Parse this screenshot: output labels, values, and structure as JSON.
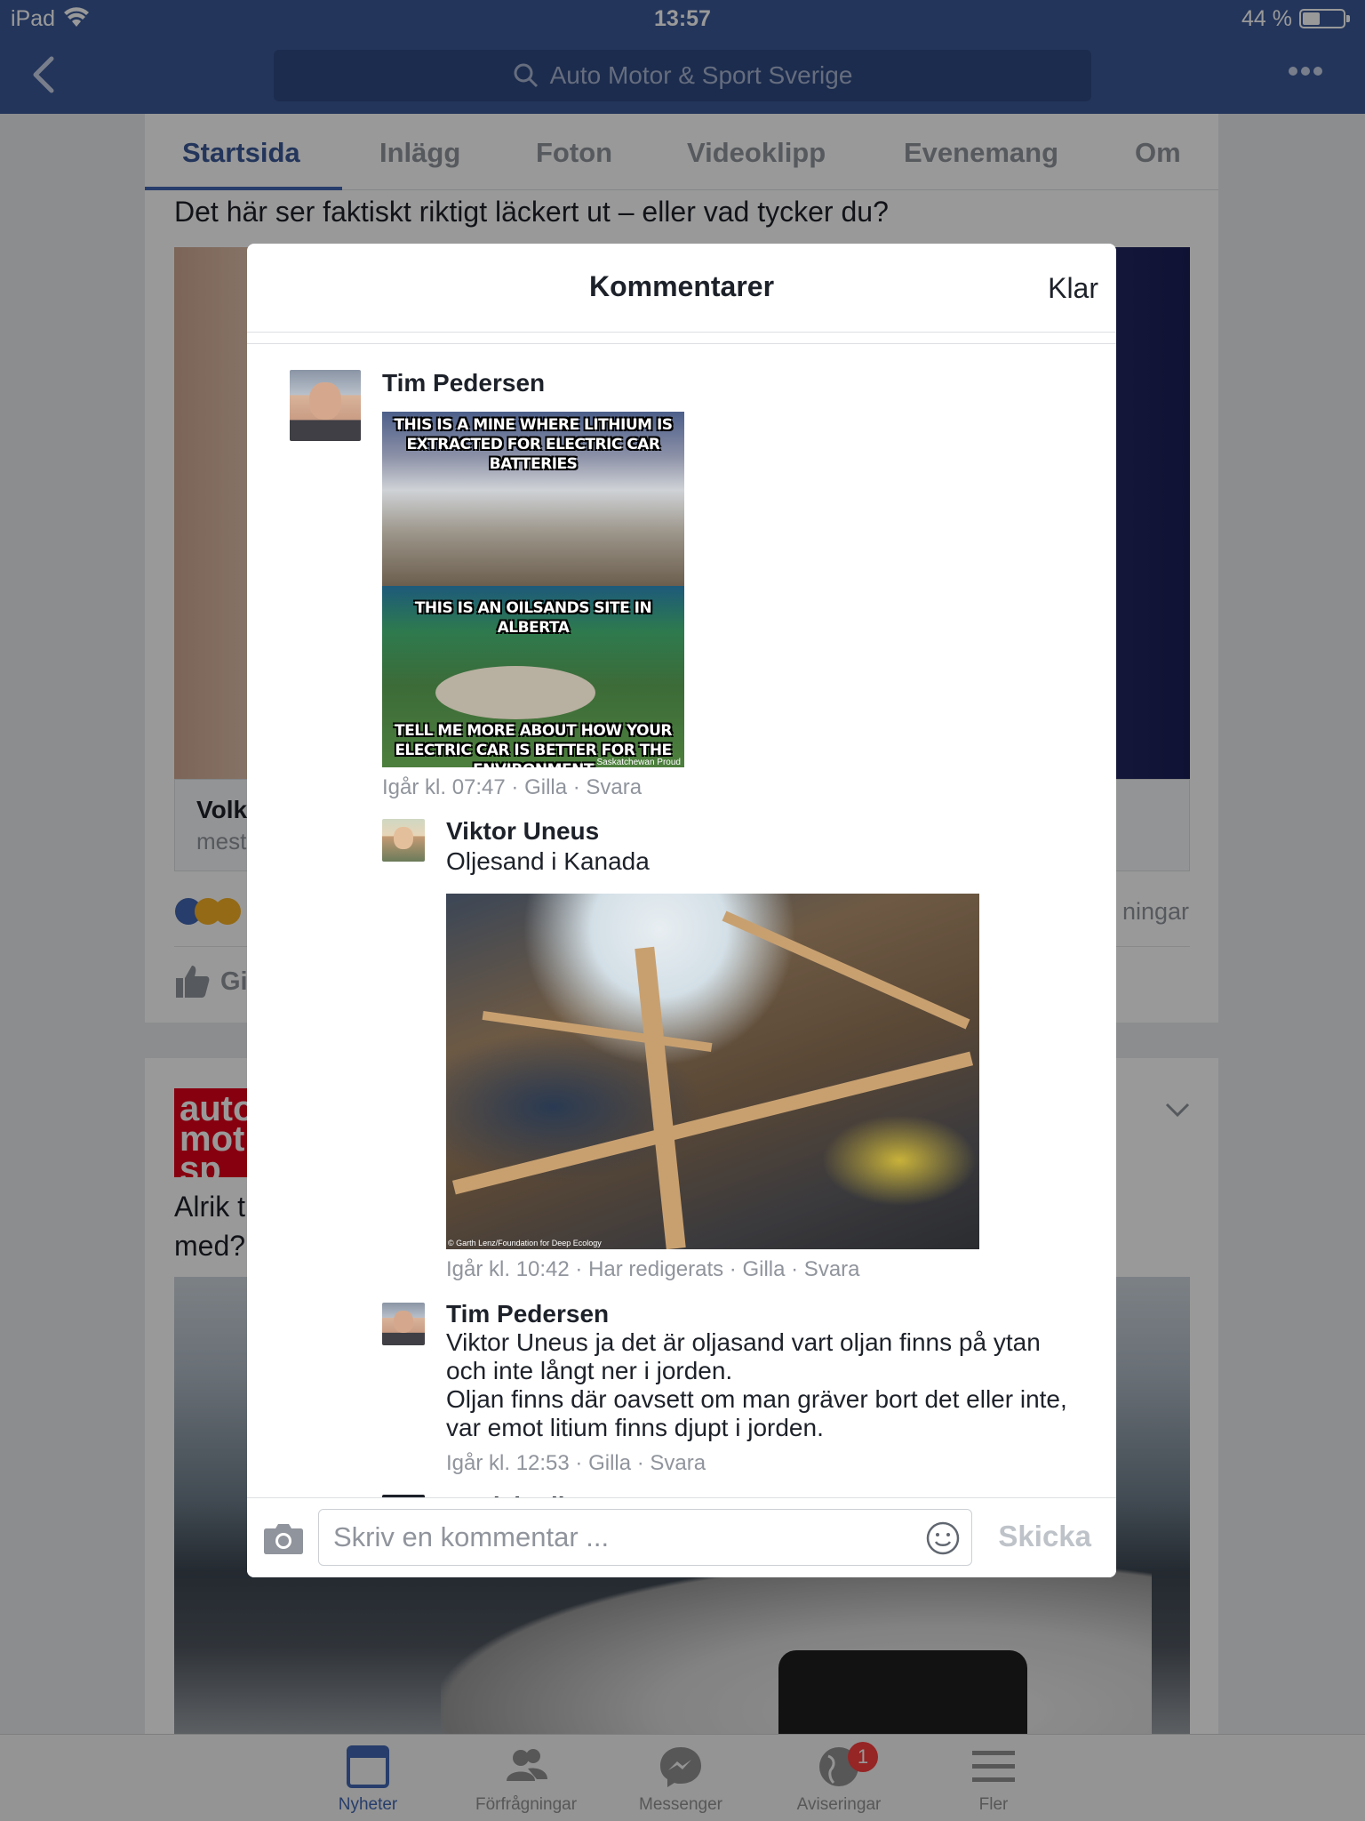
{
  "status": {
    "device": "iPad",
    "time": "13:57",
    "battery": "44 %",
    "battery_level": 0.44
  },
  "nav": {
    "search_text": "Auto Motor & Sport Sverige"
  },
  "tabs": [
    "Startsida",
    "Inlägg",
    "Foton",
    "Videoklipp",
    "Evenemang",
    "Om"
  ],
  "feed": {
    "post1_text": "Det här ser faktiskt riktigt läckert ut – eller vad tycker du?",
    "link_title": "Volk",
    "link_sub": "mest",
    "shares": "ningar",
    "like": "Gi",
    "post2_text": "Alrik t\nmed?",
    "logo": "auto\nmot\nsp"
  },
  "modal": {
    "title": "Kommentarer",
    "done": "Klar",
    "comments": [
      {
        "name": "Tim Pedersen",
        "meme": {
          "cap1": "THIS IS A MINE WHERE LITHIUM IS EXTRACTED FOR ELECTRIC CAR BATTERIES",
          "cap2": "THIS IS AN OILSANDS SITE IN ALBERTA",
          "cap3": "TELL ME MORE ABOUT HOW YOUR ELECTRIC CAR IS BETTER FOR THE ENVIRONMENT",
          "credit": "Saskatchewan Proud"
        },
        "meta": "Igår kl. 07:47 · Gilla · Svara"
      },
      {
        "name": "Viktor Uneus",
        "text": "Oljesand i Kanada",
        "image_credit": "© Garth Lenz/Foundation for Deep Ecology",
        "meta": "Igår kl. 10:42 · Har redigerats · Gilla · Svara"
      },
      {
        "name": "Tim Pedersen",
        "text": "Viktor Uneus ja det är oljasand vart oljan finns på ytan och inte långt ner i jorden.\nOljan finns där oavsett om man gräver bort det eller inte, var emot litium finns djupt i jorden.",
        "meta": "Igår kl. 12:53 · Gilla · Svara"
      },
      {
        "name": "Daniel Wik"
      }
    ],
    "composer_placeholder": "Skriv en kommentar ...",
    "send": "Skicka"
  },
  "tabbar": {
    "items": [
      "Nyheter",
      "Förfrågningar",
      "Messenger",
      "Aviseringar",
      "Fler"
    ],
    "notification_badge": "1"
  },
  "colors": {
    "facebook_blue": "#3b5998",
    "accent": "#4267b2",
    "badge": "#fa3e3e"
  }
}
